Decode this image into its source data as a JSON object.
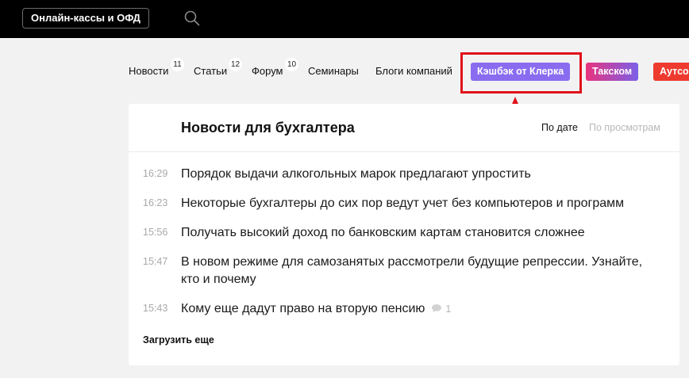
{
  "header": {
    "kassy_button": "Онлайн-кассы и ОФД",
    "search_icon": "search-icon"
  },
  "nav": {
    "items": [
      {
        "label": "Новости",
        "count": "11"
      },
      {
        "label": "Статьи",
        "count": "12"
      },
      {
        "label": "Форум",
        "count": "10"
      },
      {
        "label": "Семинары"
      },
      {
        "label": "Блоги компаний"
      }
    ],
    "pills": [
      {
        "label": "Кэшбэк от Клерка",
        "color": "#8a6cf0"
      },
      {
        "label": "Такском",
        "color": "#e8347e"
      },
      {
        "label": "Аутсо",
        "color": "#ee3b2f"
      }
    ]
  },
  "annotation": {
    "highlight_color": "#e0101a"
  },
  "news": {
    "title": "Новости для бухгалтера",
    "sort_by_date": "По дате",
    "sort_by_views": "По просмотрам",
    "items": [
      {
        "time": "16:29",
        "title": "Порядок выдачи алкогольных марок предлагают упростить"
      },
      {
        "time": "16:23",
        "title": "Некоторые бухгалтеры до сих пор ведут учет без компьютеров и программ"
      },
      {
        "time": "15:56",
        "title": "Получать высокий доход по банковским картам становится сложнее"
      },
      {
        "time": "15:47",
        "title": "В новом режиме для самозанятых рассмотрели будущие репрессии. Узнайте, кто и почему"
      },
      {
        "time": "15:43",
        "title": "Кому еще дадут право на вторую пенсию",
        "comments": "1"
      }
    ],
    "load_more": "Загрузить еще"
  }
}
